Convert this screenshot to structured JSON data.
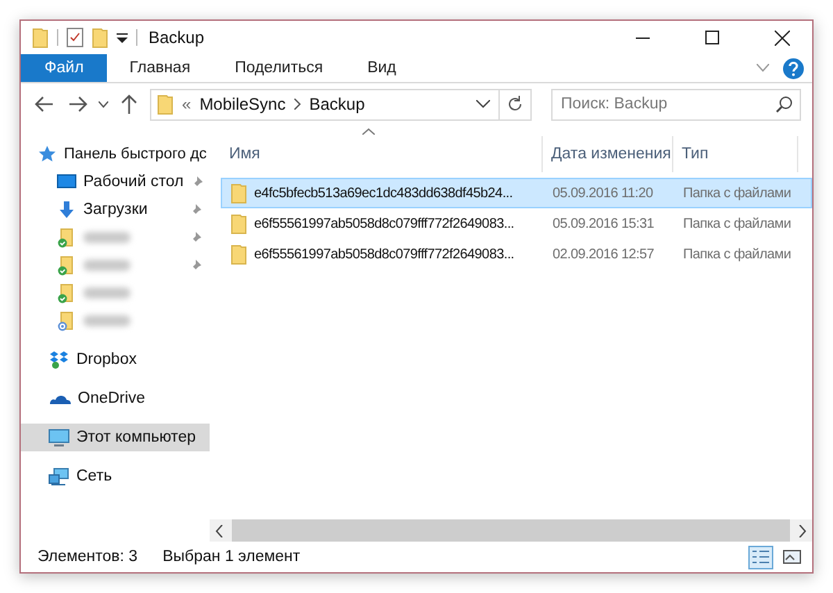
{
  "window": {
    "title": "Backup"
  },
  "ribbon_tabs": [
    {
      "label": "Файл",
      "selected": true
    },
    {
      "label": "Главная",
      "selected": false
    },
    {
      "label": "Поделиться",
      "selected": false
    },
    {
      "label": "Вид",
      "selected": false
    }
  ],
  "address_bar": {
    "separator": "«",
    "path": [
      "MobileSync",
      "Backup"
    ]
  },
  "search": {
    "placeholder": "Поиск: Backup"
  },
  "sidebar": {
    "items": [
      {
        "kind": "star",
        "label": "Панель быстрого дс",
        "selected": false,
        "children": [
          {
            "kind": "desktop",
            "label": "Рабочий стол",
            "pinned": true,
            "selected": false
          },
          {
            "kind": "download",
            "label": "Загрузки",
            "pinned": true,
            "selected": false
          },
          {
            "kind": "folder-synced",
            "pinned": true,
            "selected": false
          },
          {
            "kind": "folder-synced",
            "pinned": true,
            "selected": false
          },
          {
            "kind": "folder-synced",
            "pinned": false,
            "selected": false
          },
          {
            "kind": "folder-syncing",
            "pinned": false,
            "selected": false
          }
        ]
      },
      {
        "kind": "dropbox",
        "label": "Dropbox",
        "selected": false
      },
      {
        "kind": "cloud",
        "label": "OneDrive",
        "selected": false
      },
      {
        "kind": "computer",
        "label": "Этот компьютер",
        "selected": true
      },
      {
        "kind": "network",
        "label": "Сеть",
        "selected": false
      }
    ]
  },
  "table": {
    "columns": [
      "Имя",
      "Дата изменения",
      "Тип"
    ],
    "rows": [
      {
        "name": "e4fc5bfecb513a69ec1dc483dd638df45b24...",
        "date": "05.09.2016 11:20",
        "type": "Папка с файлами",
        "selected": true
      },
      {
        "name": "e6f55561997ab5058d8c079fff772f2649083...",
        "date": "05.09.2016 15:31",
        "type": "Папка с файлами",
        "selected": false
      },
      {
        "name": "e6f55561997ab5058d8c079fff772f2649083...",
        "date": "02.09.2016 12:57",
        "type": "Папка с файлами",
        "selected": false
      }
    ]
  },
  "status_bar": {
    "count": "Элементов: 3",
    "selection": "Выбран 1 элемент",
    "views": [
      {
        "kind": "details",
        "selected": true
      },
      {
        "kind": "thumbnails",
        "selected": false
      }
    ]
  }
}
